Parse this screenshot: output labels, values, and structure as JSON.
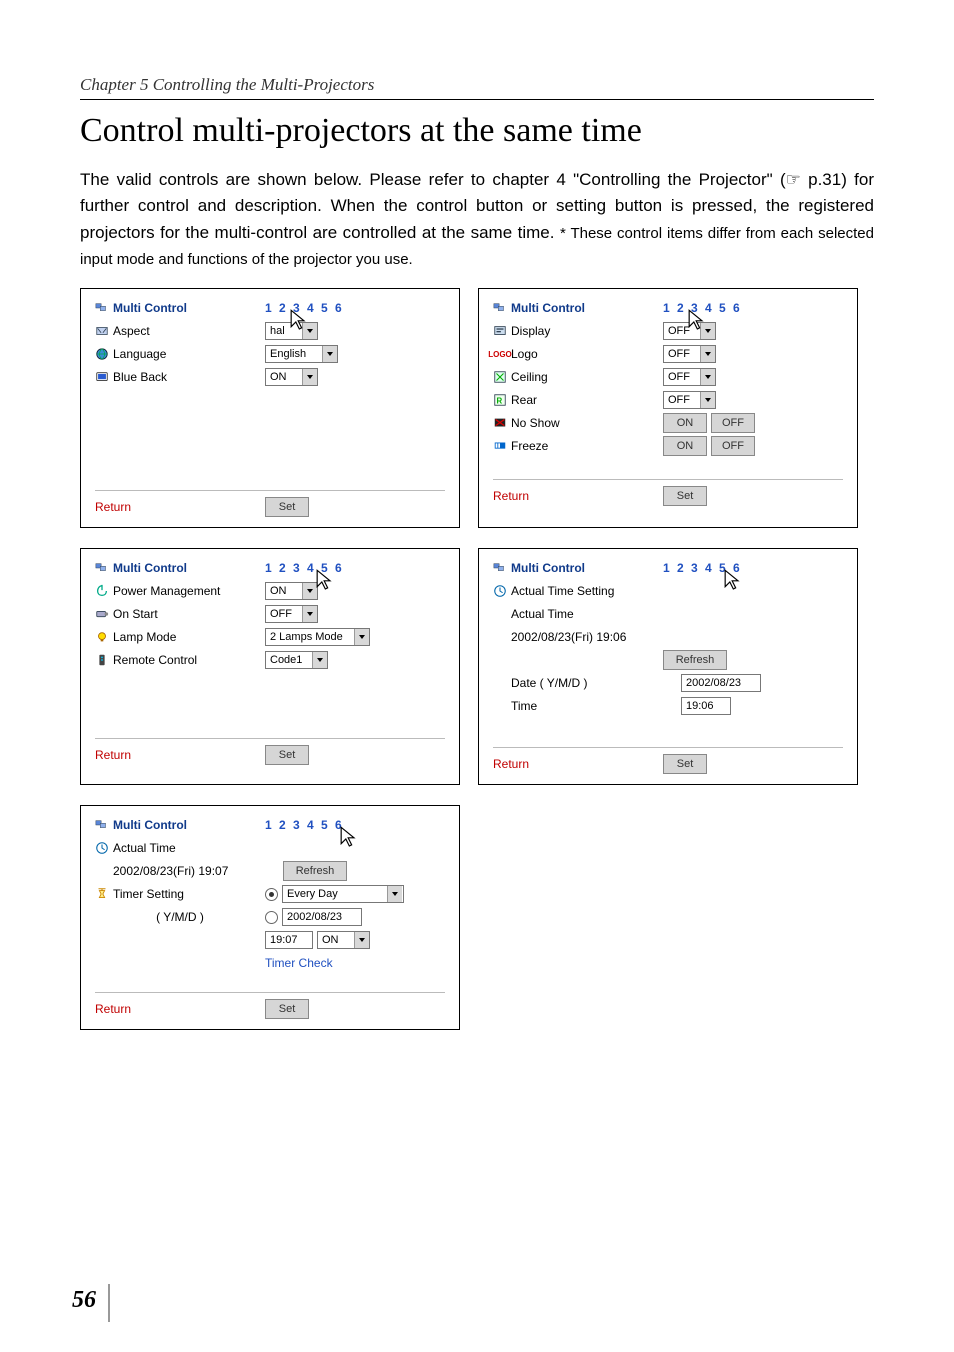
{
  "header": {
    "chapter": "Chapter 5 Controlling the Multi-Projectors"
  },
  "title": "Control multi-projectors at the same time",
  "intro": {
    "main": "The valid controls are shown below. Please refer to chapter 4 \"Controlling the Projector\" (☞ p.31)  for further control and description. When the control button or setting button is pressed, the registered projectors for the multi-control are controlled at the same time. ",
    "note": "* These control items differ from each selected input mode and functions of the projector you use."
  },
  "common": {
    "multi_control": "Multi Control",
    "numbers": "1 2 3 4 5 6",
    "return": "Return",
    "set": "Set",
    "refresh": "Refresh",
    "on": "ON",
    "off": "OFF"
  },
  "panel1": {
    "aspect": {
      "label": "Aspect",
      "value": "hal"
    },
    "language": {
      "label": "Language",
      "value": "English"
    },
    "blueback": {
      "label": "Blue Back",
      "value": "ON"
    }
  },
  "panel2": {
    "display": {
      "label": "Display",
      "value": "OFF"
    },
    "logo": {
      "label": "Logo",
      "value": "OFF"
    },
    "ceiling": {
      "label": "Ceiling",
      "value": "OFF"
    },
    "rear": {
      "label": "Rear",
      "value": "OFF"
    },
    "noshow": {
      "label": "No Show"
    },
    "freeze": {
      "label": "Freeze"
    }
  },
  "panel3": {
    "power_mgmt": {
      "label": "Power Management",
      "value": "ON"
    },
    "on_start": {
      "label": "On Start",
      "value": "OFF"
    },
    "lamp_mode": {
      "label": "Lamp Mode",
      "value": "2 Lamps Mode"
    },
    "remote": {
      "label": "Remote Control",
      "value": "Code1"
    }
  },
  "panel4": {
    "actual_setting": "Actual Time Setting",
    "actual_time_label": "Actual Time",
    "actual_time_value": "2002/08/23(Fri) 19:06",
    "date_label": "Date ( Y/M/D )",
    "date_value": "2002/08/23",
    "time_label": "Time",
    "time_value": "19:06"
  },
  "panel5": {
    "actual_time_label": "Actual Time",
    "actual_time_value": "2002/08/23(Fri) 19:07",
    "timer_setting": "Timer Setting",
    "ymd": "( Y/M/D )",
    "option_everyday": "Every Day",
    "option_date": "2002/08/23",
    "time_value": "19:07",
    "on_value": "ON",
    "timer_check": "Timer Check"
  },
  "page_number": "56"
}
